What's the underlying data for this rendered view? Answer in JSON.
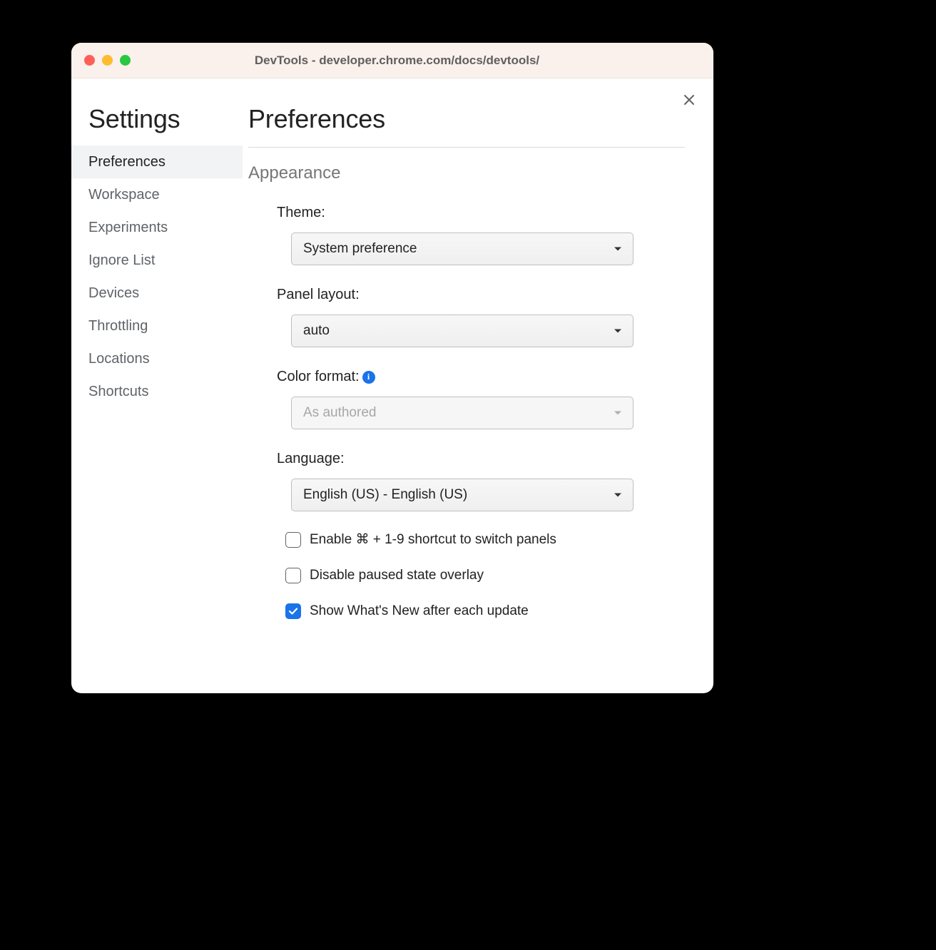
{
  "window": {
    "title": "DevTools - developer.chrome.com/docs/devtools/"
  },
  "sidebar": {
    "title": "Settings",
    "items": [
      {
        "label": "Preferences",
        "active": true
      },
      {
        "label": "Workspace",
        "active": false
      },
      {
        "label": "Experiments",
        "active": false
      },
      {
        "label": "Ignore List",
        "active": false
      },
      {
        "label": "Devices",
        "active": false
      },
      {
        "label": "Throttling",
        "active": false
      },
      {
        "label": "Locations",
        "active": false
      },
      {
        "label": "Shortcuts",
        "active": false
      }
    ]
  },
  "main": {
    "page_title": "Preferences",
    "section_title": "Appearance",
    "theme": {
      "label": "Theme:",
      "value": "System preference"
    },
    "panel_layout": {
      "label": "Panel layout:",
      "value": "auto"
    },
    "color_format": {
      "label": "Color format:",
      "value": "As authored",
      "disabled": true
    },
    "language": {
      "label": "Language:",
      "value": "English (US) - English (US)"
    },
    "checkboxes": [
      {
        "label": "Enable ⌘ + 1-9 shortcut to switch panels",
        "checked": false
      },
      {
        "label": "Disable paused state overlay",
        "checked": false
      },
      {
        "label": "Show What's New after each update",
        "checked": true
      }
    ]
  }
}
